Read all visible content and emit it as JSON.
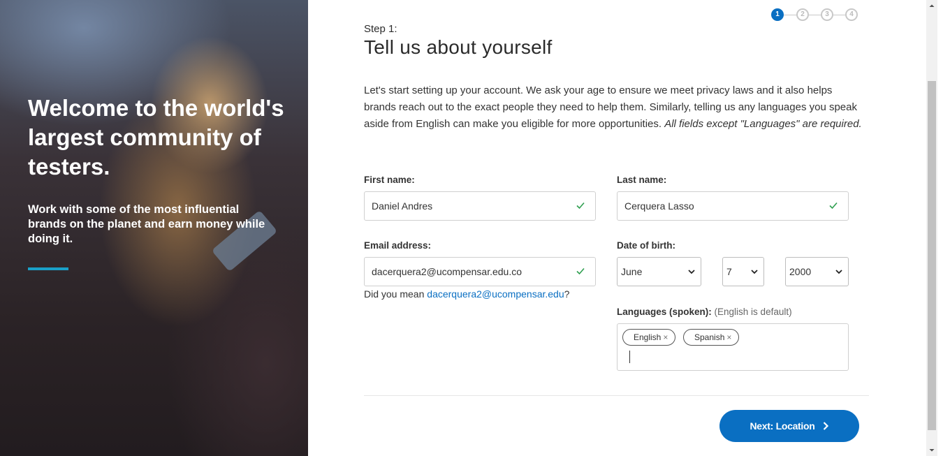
{
  "hero": {
    "heading": "Welcome to the world's largest community of testers.",
    "subheading": "Work with some of the most influential brands on the planet and earn money while doing it."
  },
  "steps": [
    "1",
    "2",
    "3",
    "4"
  ],
  "current_step": 1,
  "form": {
    "step_label": "Step 1:",
    "title": "Tell us about yourself",
    "intro": "Let's start setting up your account. We ask your age to ensure we meet privacy laws and it also helps brands reach out to the exact people they need to help them. Similarly, telling us any languages you speak aside from English can make you eligible for more opportunities. ",
    "intro_emphasis": "All fields except \"Languages\" are required.",
    "first_name": {
      "label": "First name:",
      "value": "Daniel Andres"
    },
    "last_name": {
      "label": "Last name:",
      "value": "Cerquera Lasso"
    },
    "email": {
      "label": "Email address:",
      "value": "dacerquera2@ucompensar.edu.co"
    },
    "email_hint": {
      "prefix": "Did you mean ",
      "suggestion": "dacerquera2@ucompensar.edu",
      "suffix": "?"
    },
    "dob": {
      "label": "Date of birth:",
      "month": "June",
      "day": "7",
      "year": "2000"
    },
    "languages": {
      "label": "Languages (spoken):",
      "note": "(English is default)",
      "tags": [
        "English",
        "Spanish"
      ]
    },
    "next_button": "Next: Location"
  },
  "colors": {
    "accent": "#0a6fc2",
    "hero_bar": "#1aa0c8",
    "check": "#2e9e4f"
  }
}
